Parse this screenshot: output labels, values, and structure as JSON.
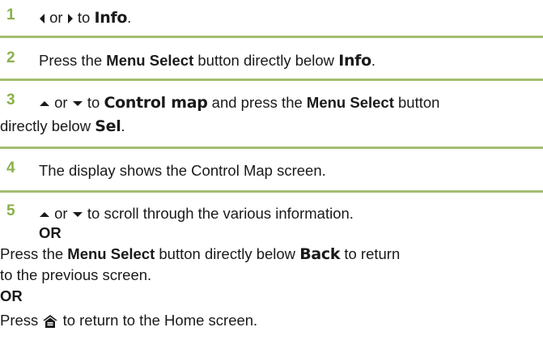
{
  "steps": [
    {
      "num": "1",
      "arrow_left": "left-arrow",
      "or": "or",
      "arrow_right": "right-arrow",
      "to": "to",
      "target": "Info",
      "end": "."
    },
    {
      "num": "2",
      "press": "Press the",
      "button": "Menu Select",
      "tail": "button directly below",
      "target": "Info",
      "end": "."
    },
    {
      "num": "3",
      "or": "or",
      "to": "to",
      "target": "Control map",
      "press": "and press the",
      "button": "Menu Select",
      "tail": "button",
      "line2": "directly below",
      "target2": "Sel",
      "end": "."
    },
    {
      "num": "4",
      "text": "The display shows the Control Map screen."
    },
    {
      "num": "5",
      "or": "or",
      "scroll": "to scroll through the various information.",
      "or_word": "OR",
      "press": "Press the",
      "button": "Menu Select",
      "tail": "button directly below",
      "back": "Back",
      "tail2": "to return",
      "line3": "to the previous screen.",
      "or_word2": "OR",
      "press2": "Press",
      "home_tail": "to return to the Home screen."
    }
  ],
  "icons": {
    "left_arrow": "left-arrow",
    "right_arrow": "right-arrow",
    "up_arrow": "up-arrow",
    "down_arrow": "down-arrow",
    "home": "home-icon"
  },
  "colors": {
    "step_number": "#8ab04a",
    "rule": "#a4be72"
  }
}
